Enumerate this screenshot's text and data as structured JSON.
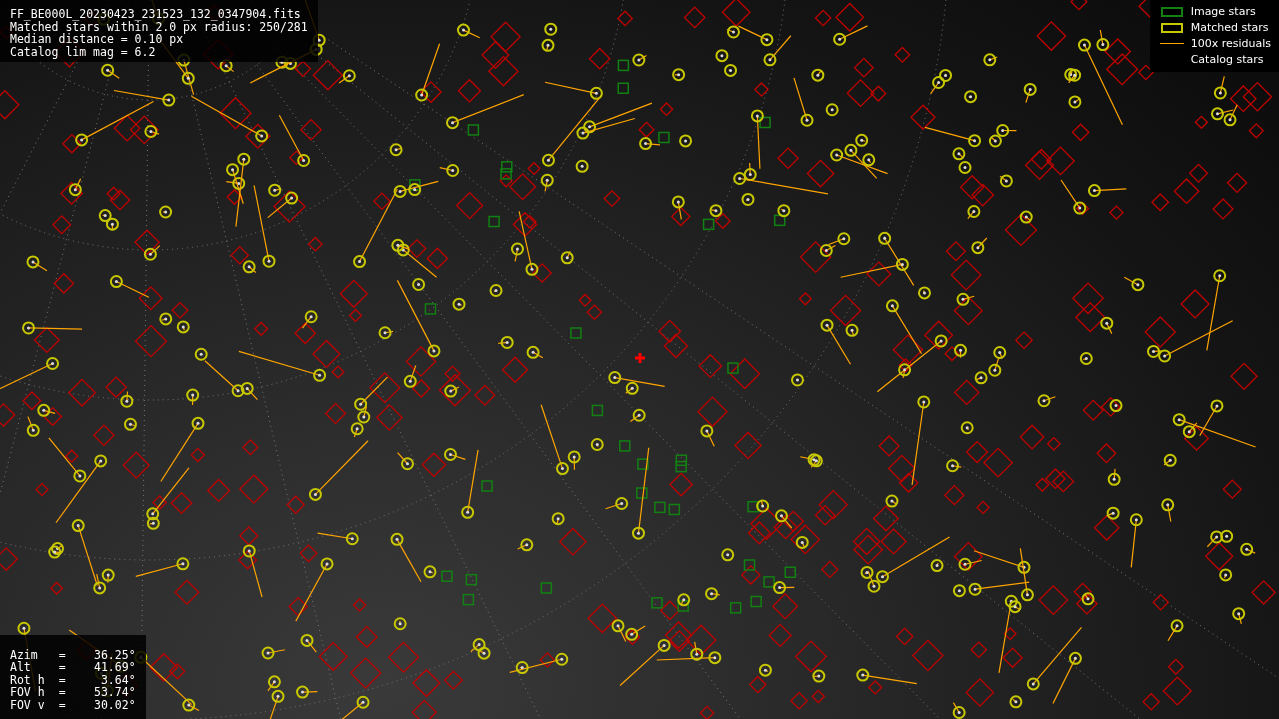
{
  "header_lines": [
    "FF_BE000L_20230423_231523_132_0347904.fits",
    "Matched stars within 2.0 px radius: 250/281",
    "Median distance = 0.10 px",
    "Catalog lim mag = 6.2"
  ],
  "legend": [
    {
      "kind": "box",
      "label": "Image stars",
      "color": "#128012"
    },
    {
      "kind": "box",
      "label": "Matched stars",
      "color": "#c8c800"
    },
    {
      "kind": "line",
      "label": "100x residuals",
      "color": "#ffa500"
    },
    {
      "kind": "plain",
      "label": "Catalog stars",
      "color": "#c00000"
    }
  ],
  "pointing": [
    {
      "name": "Azim",
      "separator": "=",
      "value": "36.25°"
    },
    {
      "name": "Alt",
      "separator": "=",
      "value": "41.69°"
    },
    {
      "name": "Rot h",
      "separator": "=",
      "value": "3.64°"
    },
    {
      "name": "FOV h",
      "separator": "=",
      "value": "53.74°"
    },
    {
      "name": "FOV v",
      "separator": "=",
      "value": "30.02°"
    }
  ]
}
